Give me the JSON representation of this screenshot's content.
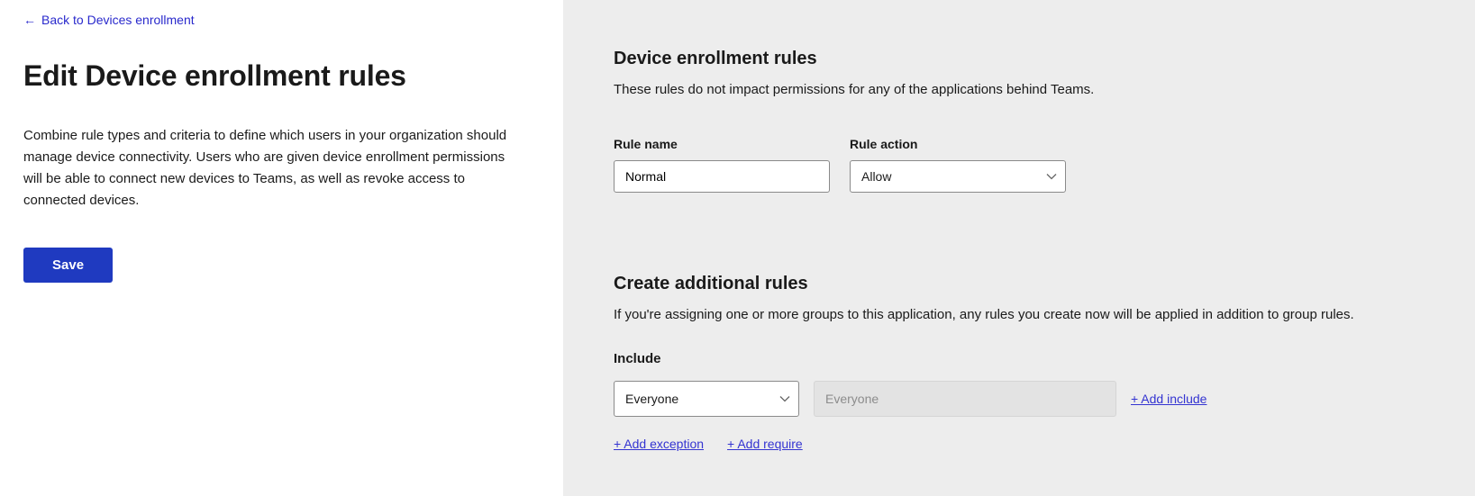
{
  "left": {
    "back_label": "Back to Devices enrollment",
    "title": "Edit Device enrollment rules",
    "description": "Combine rule types and criteria to define which users in your organization should manage device connectivity. Users who are given device enrollment permissions will be able to connect new devices to Teams, as well as revoke access to connected devices.",
    "save_label": "Save"
  },
  "right": {
    "section1_title": "Device enrollment rules",
    "section1_desc": "These rules do not impact permissions for any of the applications behind Teams.",
    "rule_name_label": "Rule name",
    "rule_name_value": "Normal",
    "rule_action_label": "Rule action",
    "rule_action_value": "Allow",
    "section2_title": "Create additional rules",
    "section2_desc": "If you're assigning one or more groups to this application, any rules you create now will be applied in addition to group rules.",
    "include_label": "Include",
    "include_select_value": "Everyone",
    "include_text_placeholder": "Everyone",
    "add_include_label": "+ Add include",
    "add_exception_label": "+ Add exception",
    "add_require_label": "+ Add require"
  }
}
